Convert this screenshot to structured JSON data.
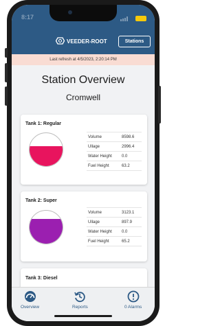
{
  "status_bar": {
    "time": "8:17"
  },
  "header": {
    "brand": "VEEDER-ROOT",
    "stations_label": "Stations"
  },
  "refresh": {
    "text": "Last refresh at 4/5/2023, 2:20:14 PM"
  },
  "page": {
    "title": "Station Overview",
    "station_name": "Cromwell"
  },
  "tanks": [
    {
      "name": "Tank 1: Regular",
      "color": "#e8145e",
      "fill_fraction": 0.6,
      "metrics": [
        {
          "label": "Volume",
          "value": "8598.6"
        },
        {
          "label": "Ullage",
          "value": "2996.4"
        },
        {
          "label": "Water Height",
          "value": "0.0"
        },
        {
          "label": "Fuel Height",
          "value": "63.2"
        }
      ]
    },
    {
      "name": "Tank 2: Super",
      "color": "#9b1fb0",
      "fill_fraction": 0.75,
      "metrics": [
        {
          "label": "Volume",
          "value": "3123.1"
        },
        {
          "label": "Ullage",
          "value": "897.9"
        },
        {
          "label": "Water Height",
          "value": "0.0"
        },
        {
          "label": "Fuel Height",
          "value": "65.2"
        }
      ]
    },
    {
      "name": "Tank 3: Diesel"
    }
  ],
  "tabs": [
    {
      "label": "Overview",
      "icon": "gauge-icon"
    },
    {
      "label": "Reports",
      "icon": "history-icon"
    },
    {
      "label": "0 Alarms",
      "icon": "alert-circle-icon"
    }
  ],
  "colors": {
    "primary": "#2d5a85",
    "banner": "#f9dcd3",
    "battery": "#f5c90b"
  }
}
